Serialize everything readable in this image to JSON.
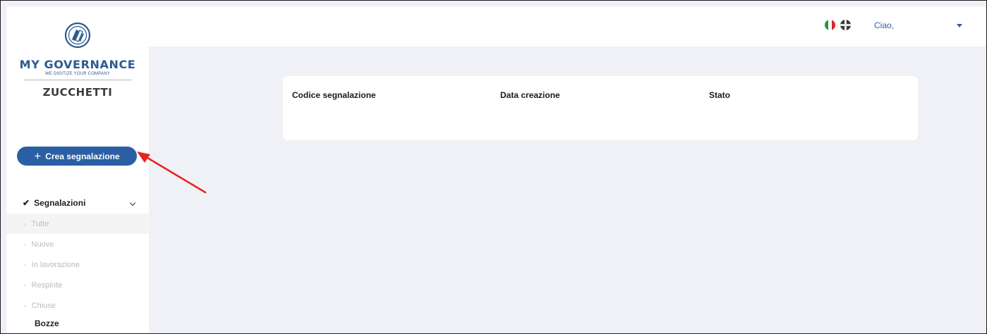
{
  "brand": {
    "name": "MY GOVERNANCE",
    "tagline": "WE DIGITIZE YOUR COMPANY",
    "company": "ZUCCHETTI"
  },
  "sidebar": {
    "create_button": "Crea segnalazione",
    "section": {
      "label": "Segnalazioni",
      "items": [
        {
          "label": "Tutte"
        },
        {
          "label": "Nuove"
        },
        {
          "label": "In lavorazione"
        },
        {
          "label": "Respinte"
        },
        {
          "label": "Chiuse"
        }
      ]
    },
    "drafts_label": "Bozze"
  },
  "header": {
    "languages": [
      "Italiano",
      "English"
    ],
    "greeting": "Ciao,"
  },
  "table": {
    "columns": [
      "Codice segnalazione",
      "Data creazione",
      "Stato"
    ],
    "rows": []
  },
  "colors": {
    "primary": "#2b5fa4",
    "background": "#f0f1f6",
    "annotation_arrow": "#e8231f"
  }
}
